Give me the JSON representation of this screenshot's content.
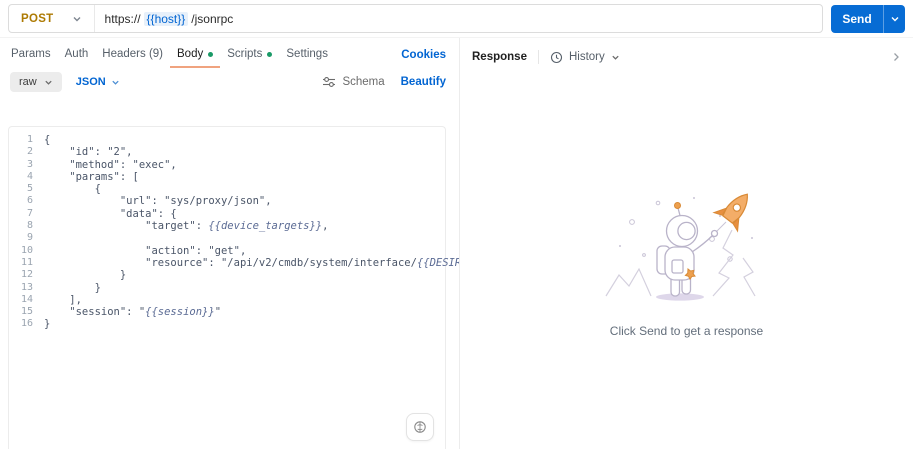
{
  "request_bar": {
    "method": "POST",
    "url_prefix": "https://",
    "url_variable": "{{host}}",
    "url_suffix": "/jsonrpc",
    "send_label": "Send"
  },
  "tabs": {
    "items": [
      {
        "label": "Params",
        "dot": false,
        "active": false
      },
      {
        "label": "Auth",
        "dot": false,
        "active": false
      },
      {
        "label": "Headers (9)",
        "dot": false,
        "active": false
      },
      {
        "label": "Body",
        "dot": true,
        "active": true
      },
      {
        "label": "Scripts",
        "dot": true,
        "active": false
      },
      {
        "label": "Settings",
        "dot": false,
        "active": false
      }
    ],
    "cookies_link": "Cookies"
  },
  "body_toolbar": {
    "format_selected": "raw",
    "language_selected": "JSON",
    "schema_label": "Schema",
    "beautify_label": "Beautify"
  },
  "editor": {
    "lines": [
      {
        "segments": [
          {
            "type": "code",
            "text": "{"
          }
        ]
      },
      {
        "segments": [
          {
            "type": "code",
            "text": "    \"id\": \"2\","
          }
        ]
      },
      {
        "segments": [
          {
            "type": "code",
            "text": "    \"method\": \"exec\","
          }
        ]
      },
      {
        "segments": [
          {
            "type": "code",
            "text": "    \"params\": ["
          }
        ]
      },
      {
        "segments": [
          {
            "type": "code",
            "text": "        {"
          }
        ]
      },
      {
        "segments": [
          {
            "type": "code",
            "text": "            \"url\": \"sys/proxy/json\","
          }
        ]
      },
      {
        "segments": [
          {
            "type": "code",
            "text": "            \"data\": {"
          }
        ]
      },
      {
        "segments": [
          {
            "type": "code",
            "text": "                \"target\": "
          },
          {
            "type": "var",
            "text": "{{device_targets}}"
          },
          {
            "type": "code",
            "text": ","
          }
        ]
      },
      {
        "segments": []
      },
      {
        "segments": [
          {
            "type": "code",
            "text": "                \"action\": \"get\","
          }
        ]
      },
      {
        "segments": [
          {
            "type": "code",
            "text": "                \"resource\": \"/api/v2/cmdb/system/interface/"
          },
          {
            "type": "var",
            "text": "{{DESIRED_INTERFACE}}"
          },
          {
            "type": "code",
            "text": "\""
          }
        ]
      },
      {
        "segments": [
          {
            "type": "code",
            "text": "            }"
          }
        ]
      },
      {
        "segments": [
          {
            "type": "code",
            "text": "        }"
          }
        ]
      },
      {
        "segments": [
          {
            "type": "code",
            "text": "    ],"
          }
        ]
      },
      {
        "segments": [
          {
            "type": "code",
            "text": "    \"session\": \""
          },
          {
            "type": "var",
            "text": "{{session}}"
          },
          {
            "type": "code",
            "text": "\""
          }
        ]
      },
      {
        "segments": [
          {
            "type": "code",
            "text": "}"
          }
        ]
      }
    ]
  },
  "response_panel": {
    "response_label": "Response",
    "history_label": "History",
    "empty_state_caption": "Click Send to get a response"
  },
  "colors": {
    "method_post": "#ad7a03",
    "accent_blue": "#0265d2",
    "send_bg": "#076cd4",
    "active_tab_underline": "#f0a37f",
    "dot_green": "#1a9a67",
    "illustration_stroke": "#c2bcd2",
    "illustration_orange": "#eb9a4d"
  }
}
